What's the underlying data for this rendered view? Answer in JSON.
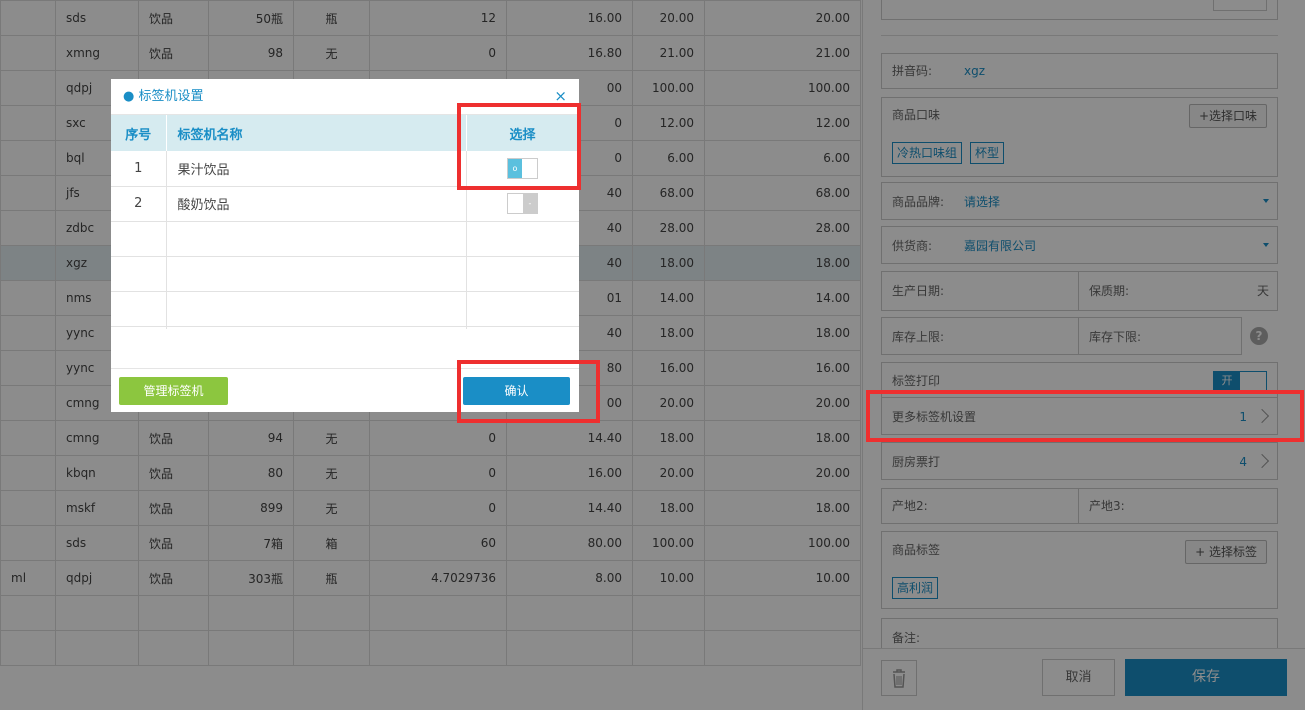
{
  "grid": {
    "rows": [
      [
        "",
        "sds",
        "饮品",
        "50瓶",
        "瓶",
        "12",
        "16.00",
        "20.00",
        "20.00"
      ],
      [
        "",
        "xmng",
        "饮品",
        "98",
        "无",
        "0",
        "16.80",
        "21.00",
        "21.00"
      ],
      [
        "",
        "qdpj",
        "",
        "",
        "",
        "",
        "00",
        "100.00",
        "100.00"
      ],
      [
        "",
        "sxc",
        "",
        "",
        "",
        "",
        "0",
        "12.00",
        "12.00"
      ],
      [
        "",
        "bql",
        "",
        "",
        "",
        "",
        "0",
        "6.00",
        "6.00"
      ],
      [
        "",
        "jfs",
        "",
        "",
        "",
        "",
        "40",
        "68.00",
        "68.00"
      ],
      [
        "",
        "zdbc",
        "",
        "",
        "",
        "",
        "40",
        "28.00",
        "28.00"
      ],
      [
        "",
        "xgz",
        "",
        "",
        "",
        "",
        "40",
        "18.00",
        "18.00"
      ],
      [
        "",
        "nms",
        "",
        "",
        "",
        "",
        "01",
        "14.00",
        "14.00"
      ],
      [
        "",
        "yync",
        "",
        "",
        "",
        "",
        "40",
        "18.00",
        "18.00"
      ],
      [
        "",
        "yync",
        "",
        "",
        "",
        "",
        "80",
        "16.00",
        "16.00"
      ],
      [
        "",
        "cmng",
        "",
        "",
        "",
        "",
        "00",
        "20.00",
        "20.00"
      ],
      [
        "",
        "cmng",
        "饮品",
        "94",
        "无",
        "0",
        "14.40",
        "18.00",
        "18.00"
      ],
      [
        "",
        "kbqn",
        "饮品",
        "80",
        "无",
        "0",
        "16.00",
        "20.00",
        "20.00"
      ],
      [
        "",
        "mskf",
        "饮品",
        "899",
        "无",
        "0",
        "14.40",
        "18.00",
        "18.00"
      ],
      [
        "",
        "sds",
        "饮品",
        "7箱",
        "箱",
        "60",
        "80.00",
        "100.00",
        "100.00"
      ],
      [
        "ml",
        "qdpj",
        "饮品",
        "303瓶",
        "瓶",
        "4.7029736",
        "8.00",
        "10.00",
        "10.00"
      ],
      [
        "",
        "",
        "",
        "",
        "",
        "",
        "",
        "",
        ""
      ],
      [
        "",
        "",
        "",
        "",
        "",
        "",
        "",
        "",
        ""
      ]
    ]
  },
  "side": {
    "pinyin_label": "拼音码:",
    "pinyin_value": "xgz",
    "flavor_label": "商品口味",
    "flavor_btn": "+选择口味",
    "flavor_tags": [
      "冷热口味组",
      "杯型"
    ],
    "brand_label": "商品品牌:",
    "brand_value": "请选择",
    "supplier_label": "供货商:",
    "supplier_value": "嘉园有限公司",
    "prod_date_label": "生产日期:",
    "shelf_label": "保质期:",
    "shelf_unit": "天",
    "stock_upper_label": "库存上限:",
    "stock_lower_label": "库存下限:",
    "help": "?",
    "label_print_label": "标签打印",
    "label_print_toggle": "开",
    "more_label_printer": "更多标签机设置",
    "more_label_count": "1",
    "kitchen_label": "厨房票打",
    "kitchen_count": "4",
    "origin2_label": "产地2:",
    "origin3_label": "产地3:",
    "tags_label": "商品标签",
    "tags_btn": "+ 选择标签",
    "tags": [
      "高利润"
    ],
    "remark_label": "备注:",
    "cancel": "取消",
    "save": "保存"
  },
  "modal": {
    "title": "● 标签机设置",
    "close": "×",
    "col_no": "序号",
    "col_name": "标签机名称",
    "col_select": "选择",
    "rows": [
      {
        "no": "1",
        "name": "果汁饮品",
        "toggle": "o"
      },
      {
        "no": "2",
        "name": "酸奶饮品",
        "toggle": "-"
      }
    ],
    "manage_btn": "管理标签机",
    "confirm_btn": "确认"
  }
}
